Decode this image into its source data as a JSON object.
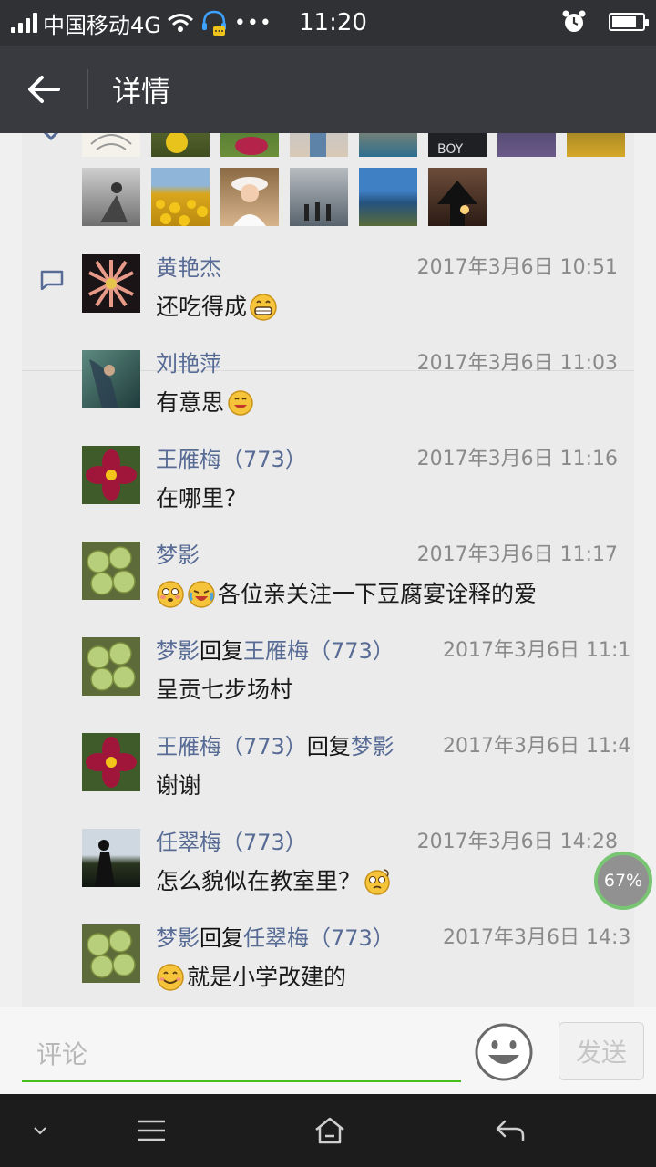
{
  "status_bar": {
    "carrier": "中国移动4G",
    "time": "11:20"
  },
  "header": {
    "title": "详情"
  },
  "comments": [
    {
      "name": "黄艳杰",
      "time": "2017年3月6日 10:51",
      "text": "还吃得成",
      "emoji_after": "grin"
    },
    {
      "name": "刘艳萍",
      "time": "2017年3月6日 11:03",
      "text": "有意思",
      "emoji_after": "smile"
    },
    {
      "name": "王雁梅（773）",
      "time": "2017年3月6日 11:16",
      "text": "在哪里？"
    },
    {
      "name": "梦影",
      "time": "2017年3月6日 11:17",
      "text": "各位亲关注一下豆腐宴诠释的爱",
      "emoji_before": [
        "surprised",
        "tears"
      ]
    },
    {
      "name": "梦影",
      "reply_word": "回复",
      "reply_to": "王雁梅（773）",
      "time": "2017年3月6日 11:1",
      "text": "呈贡七步场村"
    },
    {
      "name": "王雁梅（773）",
      "reply_word": "回复",
      "reply_to": "梦影",
      "time": "2017年3月6日 11:4",
      "text": "谢谢"
    },
    {
      "name": "任翠梅（773）",
      "time": "2017年3月6日 14:28",
      "text": "怎么貌似在教室里？",
      "emoji_after": "dizzy"
    },
    {
      "name": "梦影",
      "reply_word": "回复",
      "reply_to": "任翠梅（773）",
      "time": "2017年3月6日 14:3",
      "text": "就是小学改建的",
      "emoji_before": [
        "smile-plain"
      ]
    }
  ],
  "progress_badge": "67%",
  "input": {
    "placeholder": "评论",
    "send_label": "发送"
  },
  "colors": {
    "accent_green": "#45c01a",
    "name_blue": "#576b95",
    "title_bar": "#393a3f"
  }
}
